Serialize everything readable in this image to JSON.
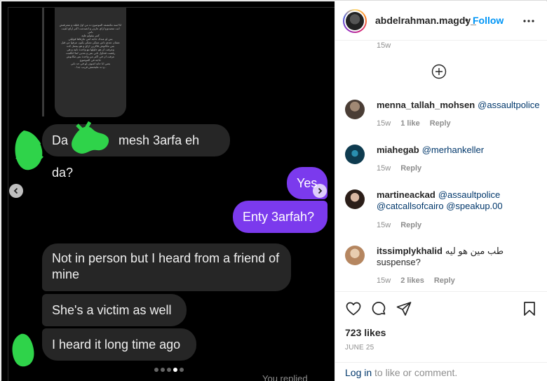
{
  "media": {
    "story_text": "انا لسة مكتشفة الموضوع ده من اول قليلة و متعرفتش\nانت متصدوع ازاي عارف و اتصدمت اكتر ازاي لقيت ناس\nكتير بيقولو عليه\nبس لو عندك حاجة انتي عارفاها قوليلي\nعشان عندي ناس ممكن ممكن يكون عرفوا من قبل\nبس مكانوش فاكرين ازاي و هو بيعمل كده\nوعرفت ان هو حاولها مع واحدة تانية و هي\nرفضت فحاول تاني بس و بعدين لما اتكلمت\nعرفت ان في اكتر من واحدة بس مكانوش\nحاجة في الموضوع\nيعني انا حابة اشوف لو في حد تاني\n- و ده عليحمش قريب جدا -",
    "messages_in": [
      "Da",
      "mesh 3arfa eh da?",
      "Not in person but I heard from a friend of mine",
      "She's a victim as well",
      "I heard it long time ago"
    ],
    "messages_out": [
      "Yes",
      "Enty 3arfah?"
    ],
    "replied_label": "You replied",
    "dots_count": 5,
    "active_dot": 3
  },
  "post": {
    "username": "abdelrahman.magdy_",
    "separator": "•",
    "follow_label": "Follow",
    "top_time": "15w",
    "comments": [
      {
        "user": "menna_tallah_mohsen",
        "text": "",
        "mentions": [
          "@assaultpolice"
        ],
        "time": "15w",
        "likes": "1 like",
        "reply": "Reply",
        "avatar_color": "#6b5a4e"
      },
      {
        "user": "miahegab",
        "text": "",
        "mentions": [
          "@merhankeller"
        ],
        "time": "15w",
        "likes": "",
        "reply": "Reply",
        "avatar_color": "#1f6f8b"
      },
      {
        "user": "martineackad",
        "text": "",
        "mentions": [
          "@assaultpolice",
          "@catcallsofcairo",
          "@speakup.00"
        ],
        "time": "15w",
        "likes": "",
        "reply": "Reply",
        "avatar_color": "#3a2a24"
      },
      {
        "user": "itssimplykhalid",
        "text": "طب مين هو ليه suspense?",
        "mentions": [],
        "time": "15w",
        "likes": "2 likes",
        "reply": "Reply",
        "avatar_color": "#c9a27a"
      }
    ],
    "likes": "723 likes",
    "date": "JUNE 25",
    "login_link": "Log in",
    "login_rest": " to like or comment."
  },
  "icons": {
    "heart": "heart-icon",
    "comment": "comment-icon",
    "share": "share-icon",
    "bookmark": "bookmark-icon",
    "more": "more-options-icon",
    "add": "add-circle-icon"
  },
  "colors": {
    "accent": "#0095f6",
    "bubble_out": "#7b3aed",
    "bubble_in": "#262626",
    "scribble": "#2fd34a"
  }
}
